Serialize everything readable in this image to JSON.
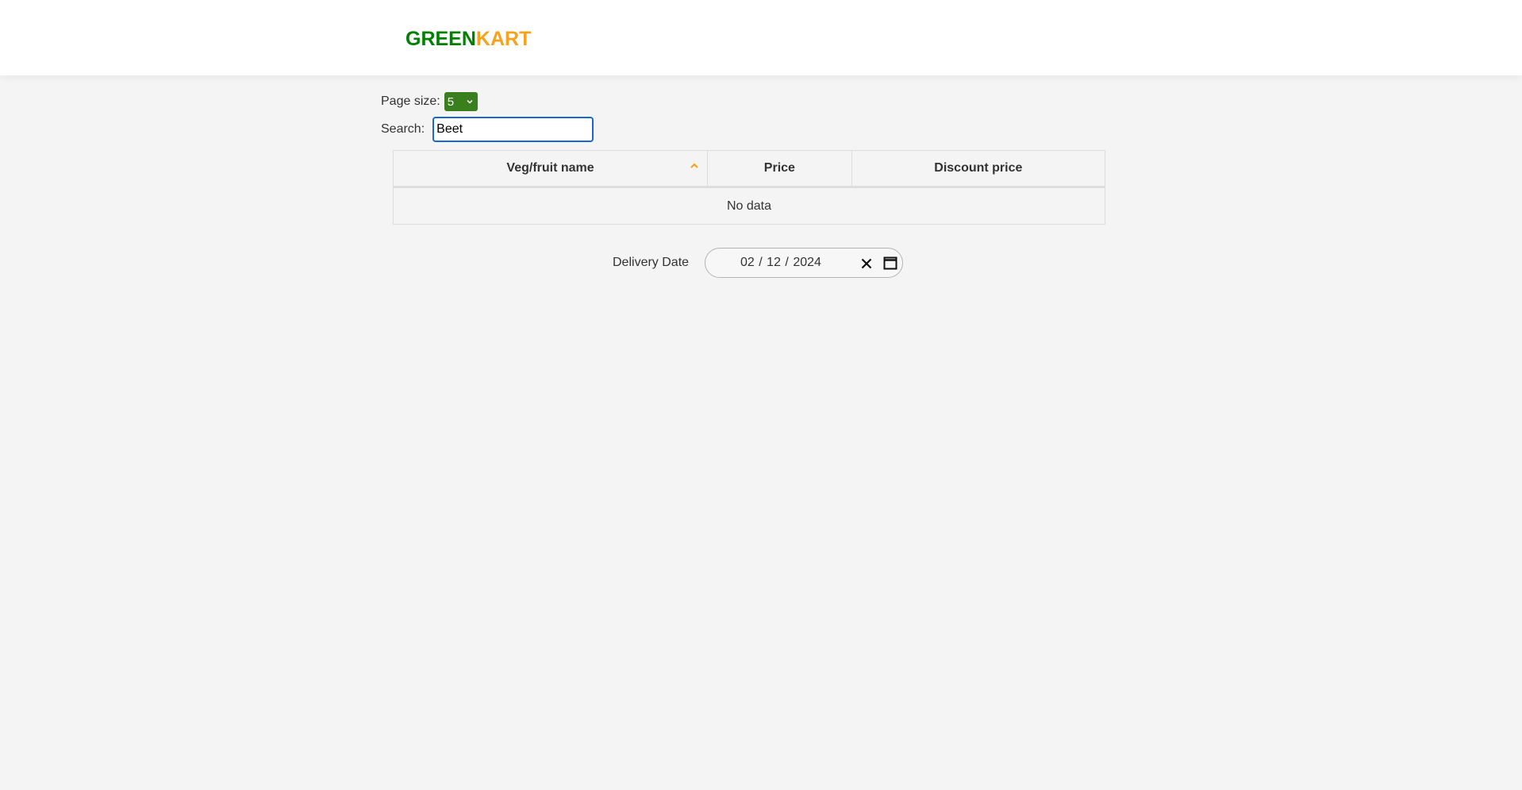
{
  "header": {
    "brand_part1": "GREEN",
    "brand_part2": "KART",
    "brand_color_primary": "#008000",
    "brand_color_accent": "#f7a21c"
  },
  "controls": {
    "page_size_label": "Page size:",
    "page_size_value": "5",
    "search_label": "Search:",
    "search_value": "Beet"
  },
  "table": {
    "columns": [
      "Veg/fruit name",
      "Price",
      "Discount price"
    ],
    "sorted_column": "Veg/fruit name",
    "sort_direction": "ascending",
    "empty_message": "No data"
  },
  "delivery": {
    "label": "Delivery Date",
    "month": "02",
    "day": "12",
    "year": "2024"
  },
  "icons": {
    "sort": "chevron-up-icon",
    "page_size_dropdown": "chevron-down-icon",
    "clear": "close-icon",
    "calendar": "calendar-icon"
  }
}
